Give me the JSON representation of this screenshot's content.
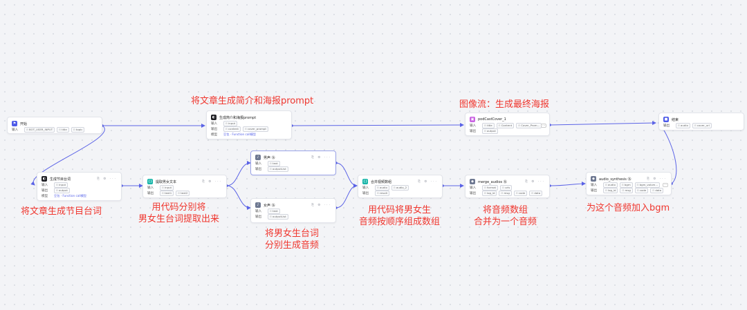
{
  "annotations": {
    "summary_prompt": "将文章生成简介和海报prompt",
    "image_flow": "图像流：生成最终海报",
    "script_gen": "将文章生成节目台词",
    "code_split_1": "用代码分别将",
    "code_split_2": "男女生台词提取出来",
    "tts_1": "将男女生台词",
    "tts_2": "分别生成音频",
    "order_1": "用代码将男女生",
    "order_2": "音频按顺序组成数组",
    "merge_1": "将音频数组",
    "merge_2": "合并为一个音频",
    "bgm": "为这个音频加入bgm"
  },
  "labels": {
    "input": "输入",
    "output": "输出",
    "model": "模型"
  },
  "nodes": {
    "start": {
      "title": "开始",
      "icon": "flag-icon",
      "inputs": [
        "BOT_USER_INPUT",
        "title",
        "topic"
      ]
    },
    "summary": {
      "title": "生成简介和海报prompt",
      "icon": "llm-icon",
      "inputs": [
        "input"
      ],
      "outputs": [
        "content",
        "cover_prompt"
      ],
      "model": "豆包 · Function call模型"
    },
    "podcast": {
      "title": "podCastCover_1",
      "icon": "image-flow-icon",
      "inputs": [
        "title",
        "Content",
        "Cover_Prom..."
      ],
      "outputs": [
        "output"
      ]
    },
    "end": {
      "title": "结束",
      "icon": "end-icon",
      "outputs": [
        "audio",
        "cover_url"
      ]
    },
    "script": {
      "title": "生成节目台词",
      "icon": "llm-icon",
      "inputs": [
        "input"
      ],
      "outputs": [
        "output"
      ],
      "model": "豆包 · Function call模型"
    },
    "extract": {
      "title": "提取男女文本",
      "icon": "code-icon",
      "inputs": [
        "input"
      ],
      "outputs": [
        "text1",
        "text2"
      ]
    },
    "male": {
      "title": "男声 ⑯",
      "icon": "speech-icon",
      "inputs": [
        "text"
      ],
      "outputs": [
        "outputList"
      ]
    },
    "female": {
      "title": "女声 ⑯",
      "icon": "speech-icon",
      "inputs": [
        "text"
      ],
      "outputs": [
        "outputList"
      ]
    },
    "combine": {
      "title": "合并视频数组",
      "icon": "code-icon",
      "inputs": [
        "audio",
        "audio_2"
      ],
      "outputs": [
        "result"
      ]
    },
    "merge": {
      "title": "merge_audios ⑯",
      "icon": "plugin-icon",
      "inputs": [
        "format",
        "urls"
      ],
      "outputs": [
        "log_id",
        "msg",
        "code",
        "data"
      ]
    },
    "synth": {
      "title": "audio_synthesis ⑯",
      "icon": "plugin-icon",
      "inputs": [
        "audio",
        "bgm",
        "bgm_volum..."
      ],
      "outputs": [
        "log_id",
        "msg",
        "code",
        "data"
      ]
    }
  },
  "colors": {
    "edge": "#5b63e6",
    "annotation": "#f0362e",
    "canvas": "#f3f4f7"
  }
}
